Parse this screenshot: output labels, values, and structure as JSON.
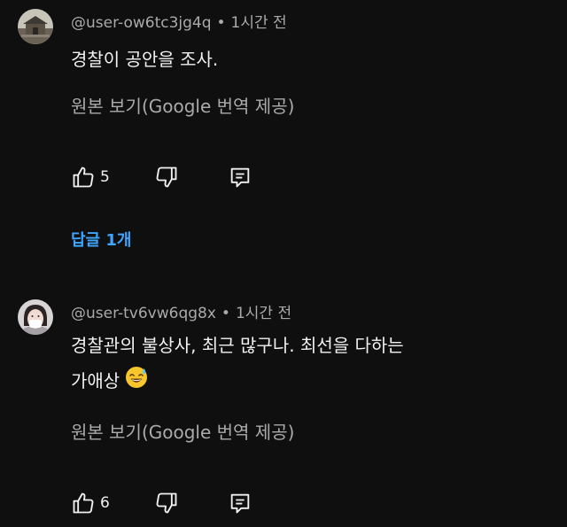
{
  "comments": [
    {
      "username": "@user-ow6tc3jg4q",
      "time": "1시간 전",
      "text_lines": [
        "경찰이 공안을 조사."
      ],
      "translate_label": "원본 보기(Google 번역 제공)",
      "like_count": "5",
      "avatar_icon": "temple-avatar"
    },
    {
      "username": "@user-tv6vw6qg8x",
      "time": "1시간 전",
      "text_lines": [
        "경찰관의 불상사, 최근 많구나. 최선을 다하는",
        "가애상"
      ],
      "emoji": "sweat-smile-emoji",
      "translate_label": "원본 보기(Google 번역 제공)",
      "like_count": "6",
      "avatar_icon": "masked-person-avatar"
    }
  ],
  "replies_label": "답글 1개",
  "separator": "•",
  "colors": {
    "background": "#0f0f0f",
    "primary_text": "#f1f1f1",
    "secondary_text": "#aaaaaa",
    "link": "#3ea6ff"
  }
}
